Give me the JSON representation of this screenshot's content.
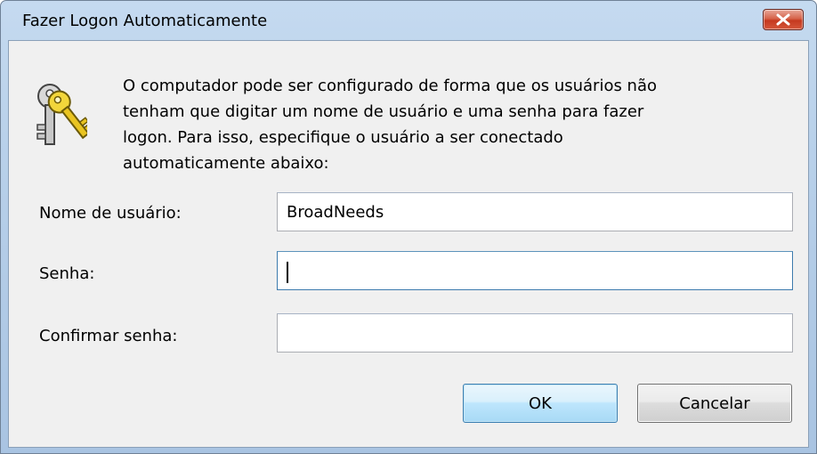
{
  "window": {
    "title": "Fazer Logon Automaticamente"
  },
  "description": {
    "lines": [
      "O computador pode ser configurado de forma que os usuários não",
      "tenham que digitar um nome de usuário e uma senha para fazer",
      "logon. Para isso, especifique o usuário a ser conectado",
      "automaticamente abaixo:"
    ]
  },
  "form": {
    "username_label": "Nome de usuário:",
    "username_value": "BroadNeeds",
    "password_label": "Senha:",
    "password_value": "",
    "confirm_label": "Confirmar senha:",
    "confirm_value": ""
  },
  "buttons": {
    "ok_label": "OK",
    "cancel_label": "Cancelar"
  },
  "icons": {
    "title_close": "close-icon",
    "dialog_icon": "keys-icon"
  },
  "colors": {
    "title_bar": "#b9d1ea",
    "client_bg": "#f0f0f0",
    "close_button": "#c5391f",
    "default_button_border": "#3c7fb1"
  }
}
